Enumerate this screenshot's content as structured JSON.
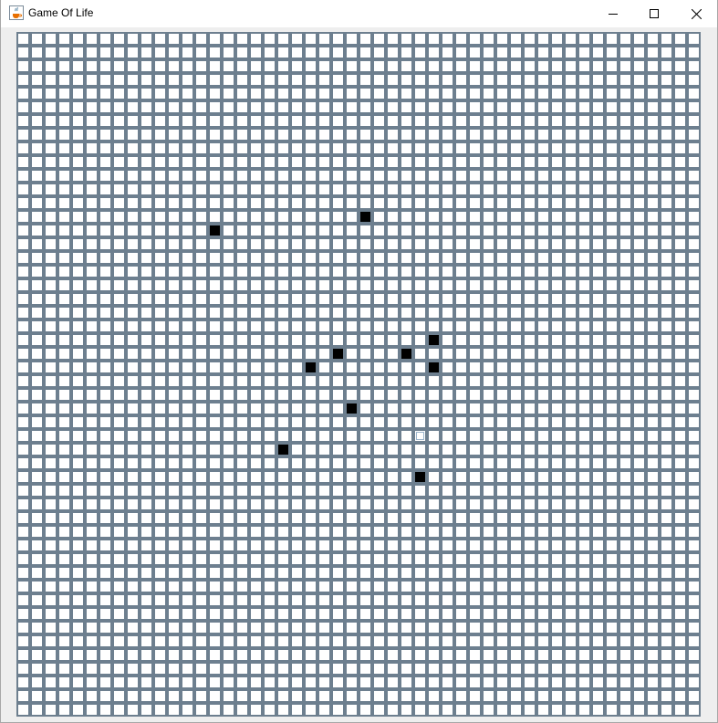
{
  "window": {
    "title": "Game Of Life",
    "app_icon": "java-cup-icon",
    "controls": [
      "minimize-icon",
      "maximize-icon",
      "close-icon"
    ]
  },
  "grid": {
    "rows": 50,
    "cols": 50,
    "alive_cells": [
      [
        13,
        25
      ],
      [
        14,
        14
      ],
      [
        22,
        30
      ],
      [
        23,
        23
      ],
      [
        23,
        28
      ],
      [
        24,
        21
      ],
      [
        24,
        30
      ],
      [
        27,
        24
      ],
      [
        30,
        19
      ],
      [
        32,
        29
      ]
    ],
    "focused_cell": [
      29,
      29
    ],
    "colors": {
      "cell_border": "#6d7f8f",
      "cell_dead": "#ffffff",
      "cell_alive": "#000000",
      "focus": "#9bb4cc",
      "window_bg": "#eeeeee"
    }
  }
}
